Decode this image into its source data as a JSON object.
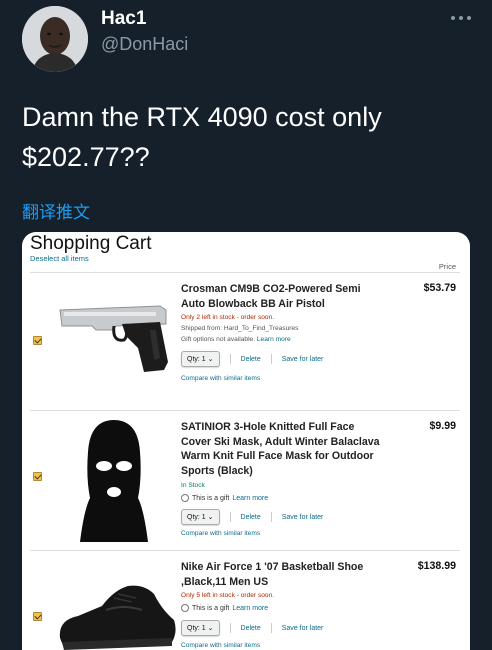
{
  "tweet": {
    "author_name": "Hac1",
    "author_handle": "@DonHaci",
    "text": "Damn the RTX 4090 cost only $202.77??",
    "translate_link": "翻译推文"
  },
  "cart": {
    "title": "Shopping Cart",
    "deselect_all": "Deselect all items",
    "price_header": "Price",
    "items": [
      {
        "title": "Crosman CM9B CO2-Powered Semi Auto Blowback BB Air Pistol",
        "price": "$53.79",
        "stock": "Only 2 left in stock - order soon.",
        "shipped_from": "Shipped from: Hard_To_Find_Treasures",
        "gift_options": "Gift options not available.",
        "learn_more": "Learn more",
        "qty_label": "Qty: 1",
        "delete_label": "Delete",
        "save_label": "Save for later",
        "compare_label": "Compare with similar items"
      },
      {
        "title": "SATINIOR 3-Hole Knitted Full Face Cover Ski Mask, Adult Winter Balaclava Warm Knit Full Face Mask for Outdoor Sports (Black)",
        "price": "$9.99",
        "stock": "In Stock",
        "gift_label": "This is a gift",
        "learn_more": "Learn more",
        "qty_label": "Qty: 1",
        "delete_label": "Delete",
        "save_label": "Save for later",
        "compare_label": "Compare with similar items"
      },
      {
        "title": "Nike Air Force 1 '07 Basketball Shoe ,Black,11 Men US",
        "price": "$138.99",
        "stock": "Only 5 left in stock - order soon.",
        "gift_label": "This is a gift",
        "learn_more": "Learn more",
        "qty_label": "Qty: 1",
        "delete_label": "Delete",
        "save_label": "Save for later",
        "compare_label": "Compare with similar items"
      }
    ]
  },
  "colors": {
    "background": "#15202b",
    "link": "#1d9bf0",
    "secondary_text": "#8b98a5",
    "checkbox": "#f0c14b"
  },
  "icons": {
    "more": "more-horizontal-icon",
    "checkbox": "checked-checkbox-icon",
    "qty_dropdown": "chevron-down-icon"
  }
}
